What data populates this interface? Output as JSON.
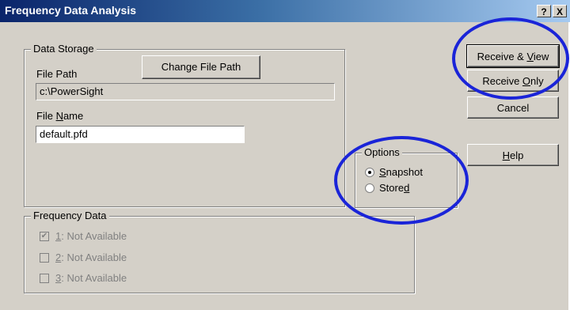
{
  "window": {
    "title": "Frequency Data Analysis",
    "help_button": "?",
    "close_button": "X"
  },
  "data_storage": {
    "legend": "Data Storage",
    "change_path_button": "Change File Path",
    "file_path_label": "File Path",
    "file_path_value": "c:\\PowerSight",
    "file_name_label": "File Name",
    "file_name_value": "default.pfd"
  },
  "options": {
    "legend": "Options",
    "snapshot_label": "Snapshot",
    "stored_label": "Stored",
    "selected": "Snapshot"
  },
  "frequency_data": {
    "legend": "Frequency Data",
    "items": [
      {
        "label": "1: Not Available",
        "checked": true
      },
      {
        "label": "2: Not Available",
        "checked": false
      },
      {
        "label": "3: Not Available",
        "checked": false
      }
    ]
  },
  "buttons": {
    "receive_view": "Receive & View",
    "receive_only": "Receive Only",
    "cancel": "Cancel",
    "help": "Help"
  },
  "annotations": {
    "highlight_color": "#1a24d8"
  }
}
